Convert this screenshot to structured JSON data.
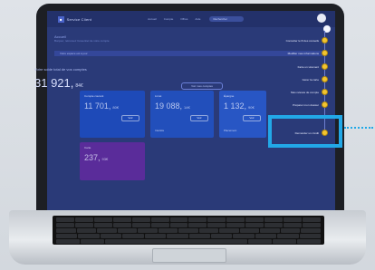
{
  "app": {
    "brand": "Service Client",
    "nav": [
      "Accueil",
      "Compte",
      "Offres",
      "Aide"
    ],
    "search_placeholder": "Rechercher",
    "page_title": "Accueil",
    "page_subtitle": "Bonjour, retrouvez l'essentiel de votre compte",
    "banner_text": "Votre espace est à jour"
  },
  "summary": {
    "label": "Votre solde total de vos comptes",
    "value": "31 921,",
    "cents": "84€",
    "button": "Voir mes comptes"
  },
  "cards": [
    {
      "label": "Compte courant",
      "value": "11 701,",
      "cents": "80€",
      "button": "Voir",
      "note": ""
    },
    {
      "label": "Livret",
      "value": "19 088,",
      "cents": "14€",
      "button": "Voir",
      "note": "Intérêts"
    },
    {
      "label": "Épargne",
      "value": "1 132,",
      "cents": "90€",
      "button": "Voir",
      "note": "Placement"
    },
    {
      "label": "Carte",
      "value": "237,",
      "cents": "93€",
      "button": "",
      "note": ""
    }
  ],
  "menu": {
    "items": [
      {
        "label": "Consulter le fil des conseils"
      },
      {
        "label": "Modifier mes informations"
      },
      {
        "label": "Faire un virement"
      },
      {
        "label": "Gérer la carte"
      },
      {
        "label": "Mes relevés de compte"
      },
      {
        "label": "Préparer mon dossier"
      },
      {
        "label": "Demander un crédit"
      }
    ]
  },
  "colors": {
    "screen_bg": "#2a3a78",
    "highlight": "#22a8e7",
    "card_blue": "#1e4ab8",
    "card_purple": "#5a2c9a"
  }
}
